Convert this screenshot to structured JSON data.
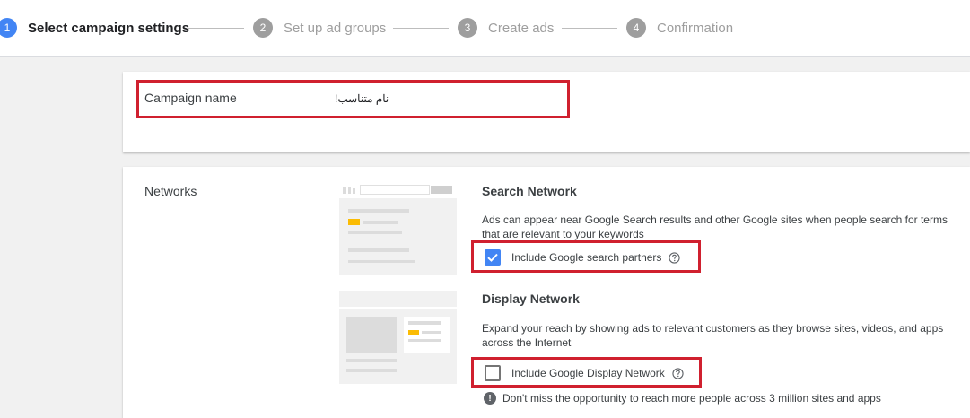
{
  "stepper": {
    "steps": [
      {
        "num": "1",
        "label": "Select campaign settings",
        "active": true
      },
      {
        "num": "2",
        "label": "Set up ad groups",
        "active": false
      },
      {
        "num": "3",
        "label": "Create ads",
        "active": false
      },
      {
        "num": "4",
        "label": "Confirmation",
        "active": false
      }
    ]
  },
  "campaign": {
    "label": "Campaign name",
    "value": "نام متناسب!"
  },
  "networks": {
    "label": "Networks",
    "search": {
      "title": "Search Network",
      "description": "Ads can appear near Google Search results and other Google sites when people search for terms that are relevant to your keywords",
      "checkbox_label": "Include Google search partners",
      "checked": true
    },
    "display": {
      "title": "Display Network",
      "description": "Expand your reach by showing ads to relevant customers as they browse sites, videos, and apps across the Internet",
      "checkbox_label": "Include Google Display Network",
      "checked": false,
      "warning": "Don't miss the opportunity to reach more people across 3 million sites and apps"
    }
  },
  "icons": {
    "help": "help-circle-icon",
    "checkmark": "checkmark-icon",
    "warning": "exclamation-circle-icon"
  },
  "colors": {
    "accent": "#4285f4",
    "highlight": "#d0202f",
    "yellow": "#fbbc04"
  }
}
